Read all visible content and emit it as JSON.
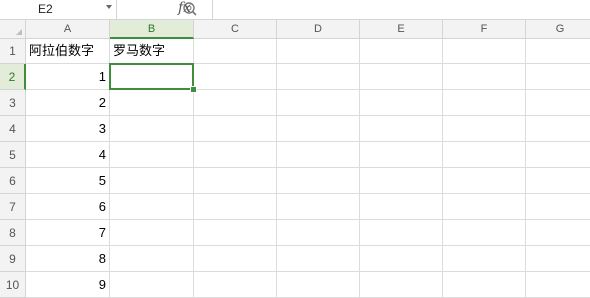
{
  "formula_bar": {
    "name_box": "E2",
    "fx_label": "fx",
    "formula_value": ""
  },
  "columns": [
    "A",
    "B",
    "C",
    "D",
    "E",
    "F",
    "G"
  ],
  "rows": [
    "1",
    "2",
    "3",
    "4",
    "5",
    "6",
    "7",
    "8",
    "9",
    "10"
  ],
  "selected_column": "B",
  "selected_row": "2",
  "cells": {
    "A1": "阿拉伯数字",
    "B1": "罗马数字",
    "A2": "1",
    "A3": "2",
    "A4": "3",
    "A5": "4",
    "A6": "5",
    "A7": "6",
    "A8": "7",
    "A9": "8",
    "A10": "9"
  },
  "colors": {
    "accent": "#3e8e3e",
    "header_bg": "#f3f3f3",
    "selected_header_bg": "#e3ebd9",
    "gridline": "#dcdcdc"
  },
  "icons": {
    "zoom": "magnifier-icon",
    "fx": "function-icon"
  }
}
